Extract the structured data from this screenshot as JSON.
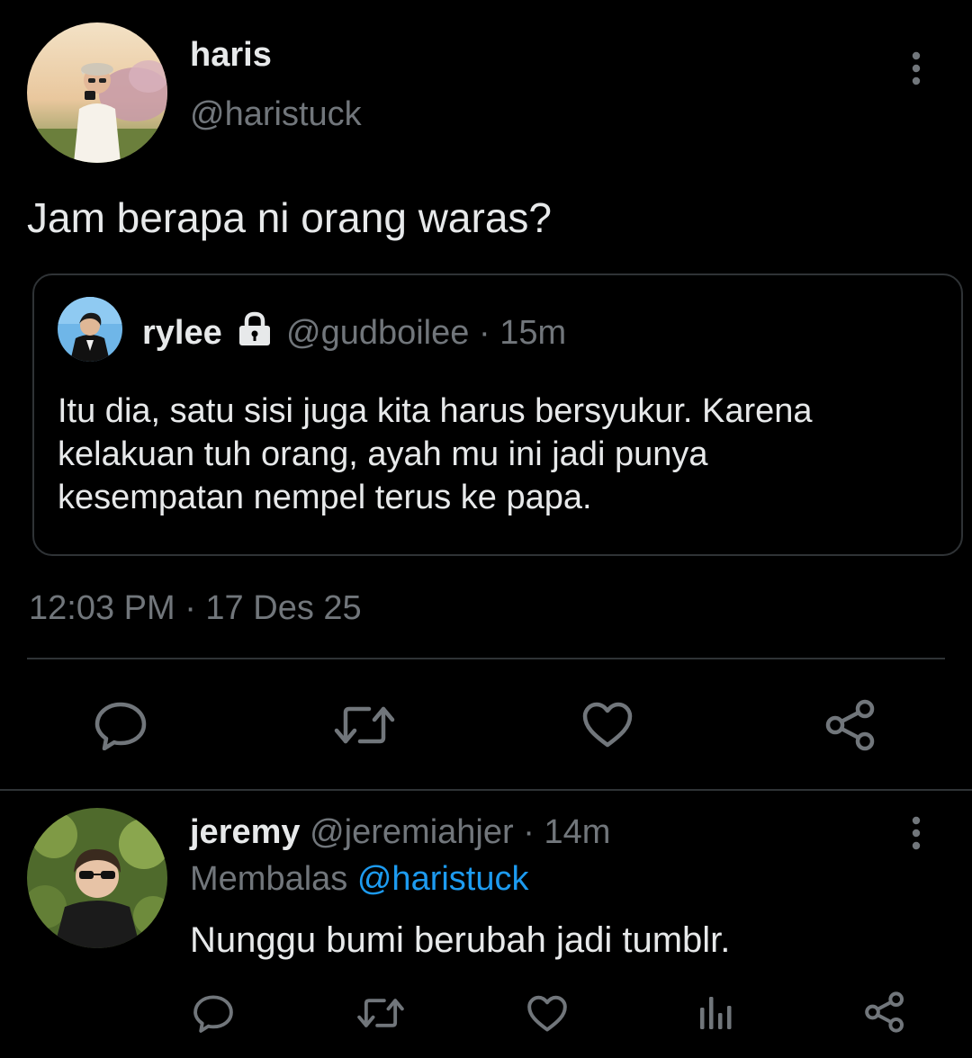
{
  "main_tweet": {
    "display_name": "haris",
    "handle": "@haristuck",
    "text": "Jam berapa ni orang waras?",
    "timestamp": "12:03 PM · 17 Des 25"
  },
  "quoted_tweet": {
    "display_name": "rylee",
    "handle": "@gudboilee",
    "separator": "·",
    "time": "15m",
    "text_lines": [
      "Itu dia, satu sisi juga kita harus bersyukur. Karena",
      "kelakuan tuh orang, ayah mu ini jadi punya",
      "kesempatan nempel terus ke papa."
    ]
  },
  "reply": {
    "display_name": "jeremy",
    "handle": "@jeremiahjer",
    "separator": "·",
    "time": "14m",
    "replying_prefix": "Membalas",
    "replying_to": "@haristuck",
    "text": "Nunggu bumi berubah jadi tumblr."
  },
  "colors": {
    "background": "#000000",
    "text": "#e7e9ea",
    "muted": "#71767b",
    "link": "#1d9bf0",
    "border": "#2f3336"
  },
  "icons": {
    "more": "more-vertical-icon",
    "reply": "reply-icon",
    "retweet": "retweet-icon",
    "like": "heart-icon",
    "share": "share-icon",
    "views": "views-icon",
    "lock": "lock-icon"
  }
}
